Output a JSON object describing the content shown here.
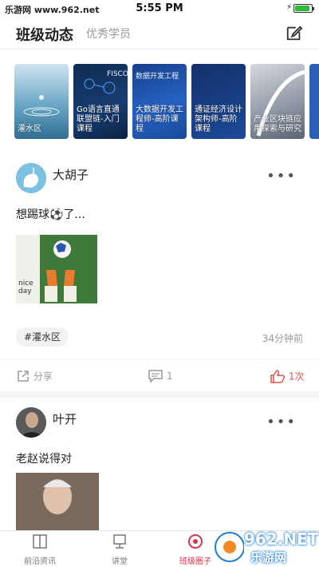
{
  "status_bar": {
    "site": "乐游网 www.962.net",
    "time": "5:55 PM",
    "battery_level": 0.9
  },
  "top_nav": {
    "active_tab": "班级动态",
    "inactive_tab": "优秀学员",
    "edit_icon": "edit-icon"
  },
  "banners": [
    {
      "label": "灌水区",
      "top": ""
    },
    {
      "label": "Go语言直通联盟链-入门课程",
      "top": "FISCO"
    },
    {
      "label": "大数据开发工程师-高阶课程",
      "top": "数据开发工程"
    },
    {
      "label": "通证经济设计架构师-高阶课程",
      "top": ""
    },
    {
      "label": "产业区块链应用探索与研究",
      "top": ""
    }
  ],
  "posts": [
    {
      "author": "大胡子",
      "text": "想踢球⚽了...",
      "tag": "#灌水区",
      "time": "34分钟前",
      "share_label": "分享",
      "comment_count": "1",
      "like_count": "1次",
      "image_caption": "nice day"
    },
    {
      "author": "叶开",
      "text": "老赵说得对"
    }
  ],
  "tabbar": [
    {
      "label": "前沿资讯",
      "icon": "book-icon"
    },
    {
      "label": "讲堂",
      "icon": "monitor-icon"
    },
    {
      "label": "班级圈子",
      "icon": "circle-icon"
    }
  ],
  "watermark": {
    "brand": "962.NET",
    "text": "乐游网"
  },
  "colors": {
    "accent": "#d9334a",
    "muted": "#999999"
  }
}
